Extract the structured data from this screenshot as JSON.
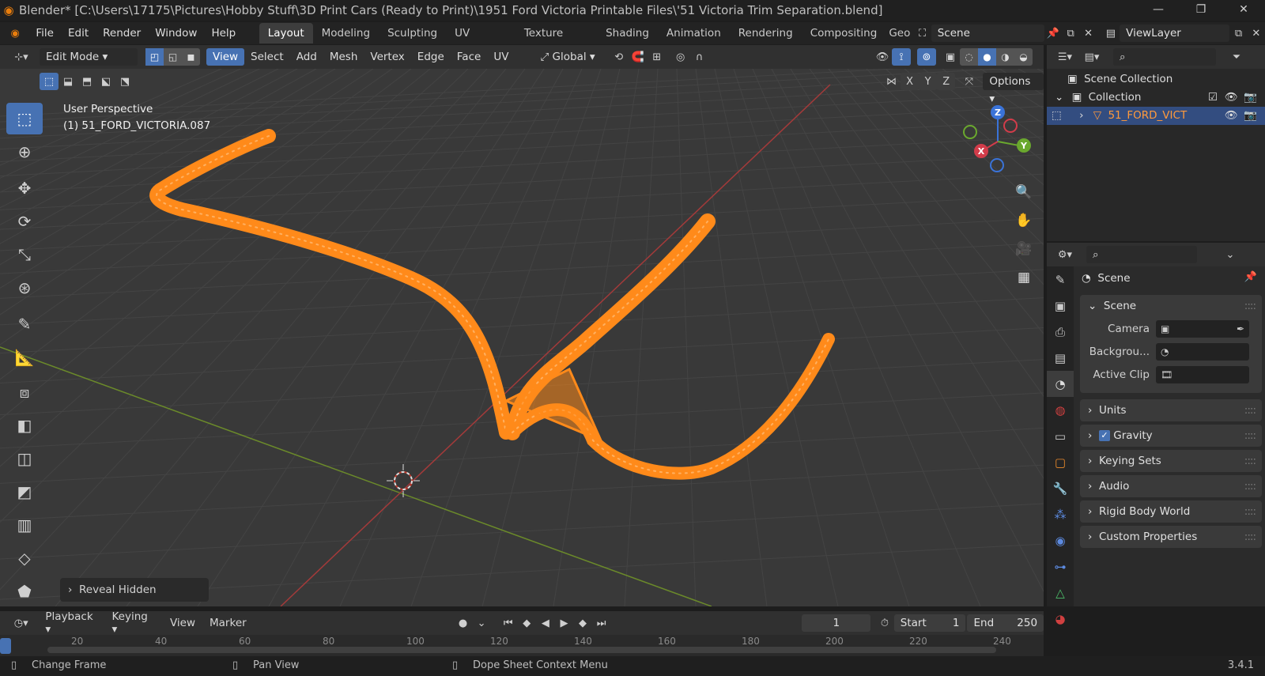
{
  "window": {
    "title": "Blender* [C:\\Users\\17175\\Pictures\\Hobby Stuff\\3D Print Cars (Ready to Print)\\1951 Ford Victoria Printable Files\\'51 Victoria Trim Separation.blend]"
  },
  "menu": [
    "File",
    "Edit",
    "Render",
    "Window",
    "Help"
  ],
  "workspaces": [
    "Layout",
    "Modeling",
    "Sculpting",
    "UV Editing",
    "Texture Paint",
    "Shading",
    "Animation",
    "Rendering",
    "Compositing",
    "Geo"
  ],
  "scene_field": "Scene",
  "view_layer_field": "ViewLayer",
  "viewport_header": {
    "mode": "Edit Mode",
    "menus": [
      "View",
      "Select",
      "Add",
      "Mesh",
      "Vertex",
      "Edge",
      "Face",
      "UV"
    ],
    "transform_orientation": "Global",
    "options_label": "Options",
    "axes": [
      "X",
      "Y",
      "Z"
    ]
  },
  "viewport": {
    "view_name": "User Perspective",
    "object_name": "(1) 51_FORD_VICTORIA.087",
    "gizmo_axes": [
      "Z",
      "Y",
      "X"
    ],
    "last_operator": "Reveal Hidden",
    "mesh_color": "#ff8a1a"
  },
  "outliner": {
    "search_placeholder": "",
    "rows": [
      {
        "label": "Scene Collection"
      },
      {
        "label": "Collection"
      },
      {
        "label": "51_FORD_VICT"
      }
    ]
  },
  "properties": {
    "context_label": "Scene",
    "scene_panel": {
      "title": "Scene",
      "rows": [
        {
          "label": "Camera"
        },
        {
          "label": "Backgrou..."
        },
        {
          "label": "Active Clip"
        }
      ]
    },
    "collapsed_panels": [
      "Units",
      "Gravity",
      "Keying Sets",
      "Audio",
      "Rigid Body World",
      "Custom Properties"
    ]
  },
  "timeline": {
    "menus": [
      "Playback",
      "Keying",
      "View",
      "Marker"
    ],
    "current_frame": "1",
    "start_label": "Start",
    "start_value": "1",
    "end_label": "End",
    "end_value": "250",
    "ticks": [
      "20",
      "40",
      "60",
      "80",
      "100",
      "120",
      "140",
      "160",
      "180",
      "200",
      "220",
      "240"
    ]
  },
  "statusbar": {
    "items": [
      "Change Frame",
      "Pan View",
      "Dope Sheet Context Menu"
    ],
    "version": "3.4.1"
  }
}
